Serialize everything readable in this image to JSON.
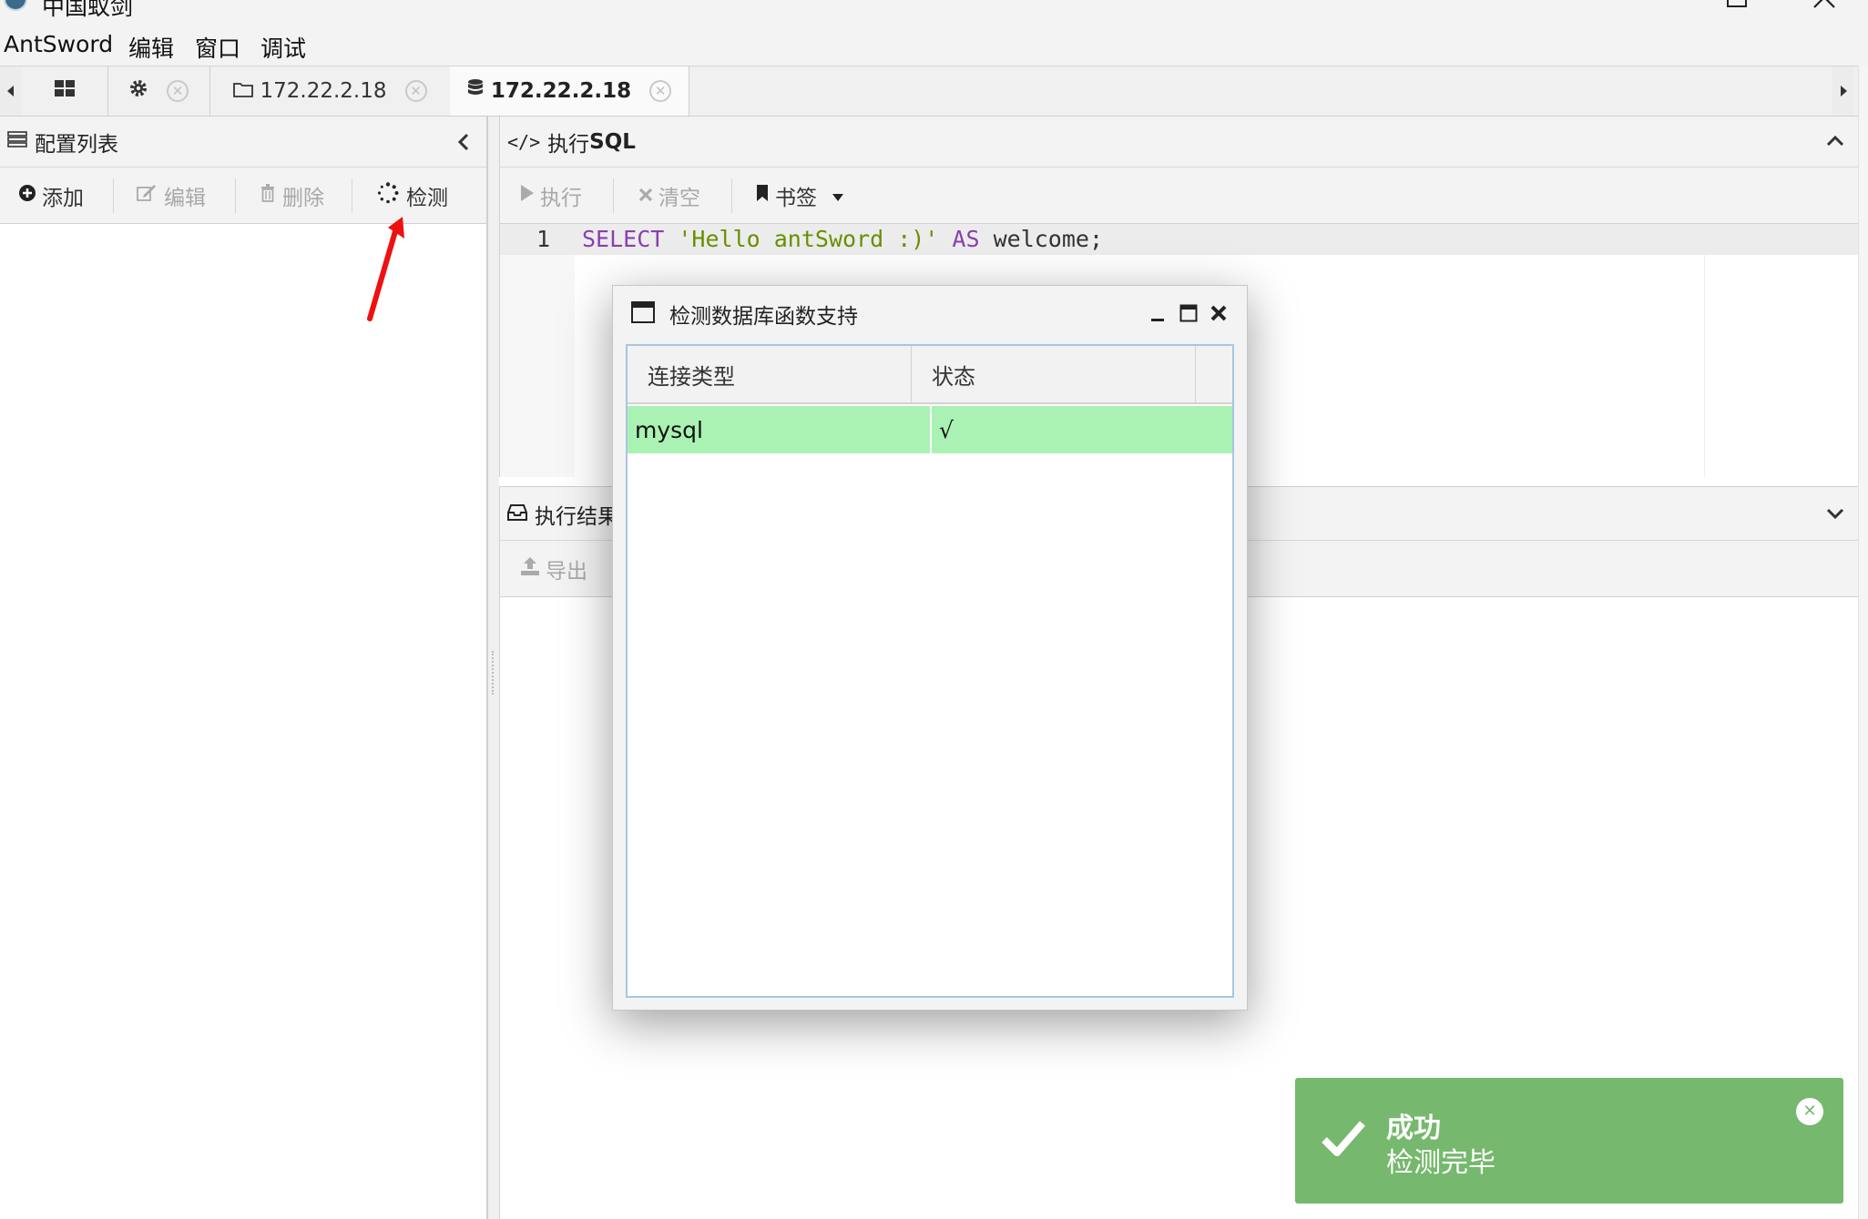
{
  "window": {
    "title": "中国蚁剑"
  },
  "menu": [
    "AntSword",
    "编辑",
    "窗口",
    "调试"
  ],
  "tabs": [
    {
      "icon": "grid-icon",
      "label": ""
    },
    {
      "icon": "gear-icon",
      "label": ""
    },
    {
      "icon": "folder-icon",
      "label": "172.22.2.18"
    },
    {
      "icon": "database-icon",
      "label": "172.22.2.18",
      "active": true
    }
  ],
  "left_panel": {
    "title": "配置列表",
    "toolbar": {
      "add": "添加",
      "edit": "编辑",
      "delete": "删除",
      "check": "检测"
    }
  },
  "sql_panel": {
    "title_prefix": "</>",
    "title_text": "执行",
    "title_bold": "SQL",
    "toolbar": {
      "execute": "执行",
      "clear": "清空",
      "bookmark": "书签"
    },
    "editor": {
      "line_number": "1",
      "keyword1": "SELECT",
      "string": "'Hello antSword :)'",
      "keyword2": "AS",
      "tail": "welcome;"
    }
  },
  "result_panel": {
    "title": "执行结果",
    "toolbar": {
      "export": "导出"
    }
  },
  "modal": {
    "title": "检测数据库函数支持",
    "columns": [
      "连接类型",
      "状态"
    ],
    "rows": [
      {
        "type": "mysql",
        "status": "√"
      }
    ]
  },
  "toast": {
    "title": "成功",
    "message": "检测完毕"
  },
  "colors": {
    "success_green": "#76b86d",
    "row_green": "#aaf2b4",
    "annotation_red": "#ee1111"
  }
}
